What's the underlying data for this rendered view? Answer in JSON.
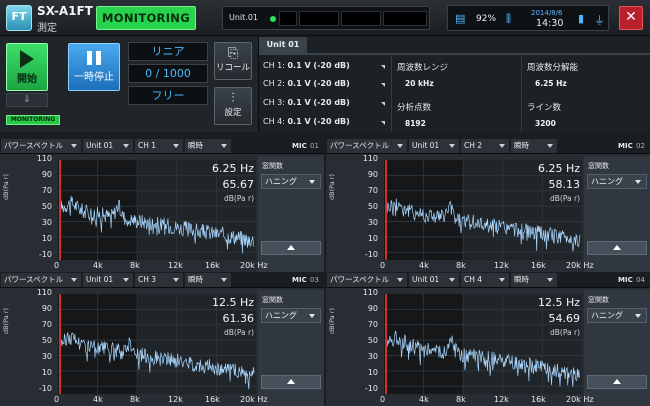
{
  "app": {
    "logo": "FT",
    "model": "SX-A1FT",
    "mode": "測定",
    "status": "MONITORING"
  },
  "statusbar": {
    "unit": "Unit.01"
  },
  "system": {
    "battery_pct": "92%",
    "date": "2014/8/6",
    "time": "14:30",
    "accent": "#4fb7ff"
  },
  "controls": {
    "start_label": "開始",
    "pause_label": "一時停止",
    "monitoring_small": "MONITORING",
    "averaging": "リニア",
    "count": "0 / 1000",
    "trigger": "フリー",
    "recall_label": "リコール",
    "settings_label": "設定"
  },
  "info": {
    "unit_tab": "Unit 01",
    "channels": [
      {
        "label": "CH 1:",
        "value": "0.1 V (-20 dB)"
      },
      {
        "label": "CH 2:",
        "value": "0.1 V (-20 dB)"
      },
      {
        "label": "CH 3:",
        "value": "0.1 V (-20 dB)"
      },
      {
        "label": "CH 4:",
        "value": "0.1 V (-20 dB)"
      }
    ],
    "freq_range_label": "周波数レンジ",
    "freq_range_value": "20 kHz",
    "analysis_points_label": "分析点数",
    "analysis_points_value": "8192",
    "freq_resolution_label": "周波数分解能",
    "freq_resolution_value": "6.25 Hz",
    "lines_label": "ライン数",
    "lines_value": "3200"
  },
  "panels": [
    {
      "type": "パワースペクトル",
      "unit": "Unit 01",
      "ch": "CH 1",
      "mode": "瞬時",
      "mic": "MIC",
      "mic_no": "01",
      "hz": "6.25 Hz",
      "value": "65.67",
      "unit_label": "dB(Pa r)",
      "window_label": "窓関数",
      "window": "ハニング"
    },
    {
      "type": "パワースペクトル",
      "unit": "Unit 01",
      "ch": "CH 2",
      "mode": "瞬時",
      "mic": "MIC",
      "mic_no": "02",
      "hz": "6.25 Hz",
      "value": "58.13",
      "unit_label": "dB(Pa r)",
      "window_label": "窓関数",
      "window": "ハニング"
    },
    {
      "type": "パワースペクトル",
      "unit": "Unit 01",
      "ch": "CH 3",
      "mode": "瞬時",
      "mic": "MIC",
      "mic_no": "03",
      "hz": "12.5 Hz",
      "value": "61.36",
      "unit_label": "dB(Pa r)",
      "window_label": "窓関数",
      "window": "ハニング"
    },
    {
      "type": "パワースペクトル",
      "unit": "Unit 01",
      "ch": "CH 4",
      "mode": "瞬時",
      "mic": "MIC",
      "mic_no": "04",
      "hz": "12.5 Hz",
      "value": "54.69",
      "unit_label": "dB(Pa r)",
      "window_label": "窓関数",
      "window": "ハニング"
    }
  ],
  "chart_data": {
    "type": "line",
    "yticks": [
      "110",
      "90",
      "70",
      "50",
      "30",
      "10",
      "-10"
    ],
    "xticks": [
      "0",
      "4k",
      "8k",
      "12k",
      "16k",
      "20k Hz"
    ],
    "ylabel": "dB(Pa r)",
    "ylim": [
      -20,
      110
    ],
    "xlim": [
      0,
      20000
    ],
    "line_color": "#a9d6ff",
    "cursor_color": "#d23030"
  }
}
